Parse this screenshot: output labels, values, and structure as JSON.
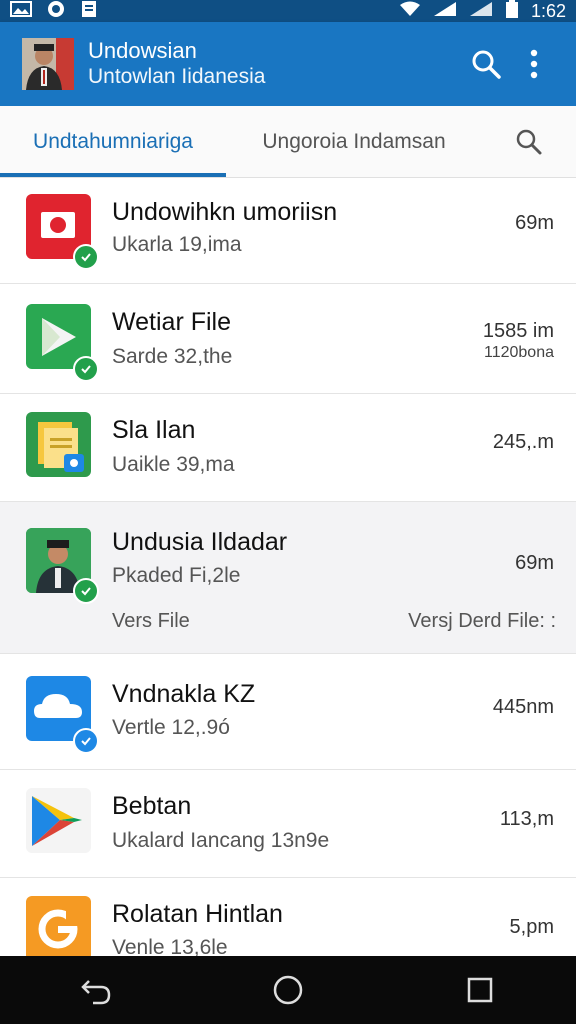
{
  "status_bar": {
    "time": "1:62",
    "icons": [
      "gallery-icon",
      "shield-icon",
      "clipboard-icon",
      "wifi-icon",
      "signal-icon",
      "signal-icon",
      "battery-icon"
    ]
  },
  "app_bar": {
    "title": "Undowsian",
    "subtitle": "Untowlan Iidanesia",
    "actions": [
      "search-icon",
      "more-vert-icon"
    ]
  },
  "tabs": [
    {
      "label": "Undtahumniariga",
      "active": true
    },
    {
      "label": "Ungoroia Indamsan",
      "active": false
    }
  ],
  "apps": [
    {
      "name": "Undowihkn umoriisn",
      "sub": "Ukarla 19,ima",
      "size": "69m",
      "size2": "",
      "icon": "red-app-icon",
      "badge": "green"
    },
    {
      "name": "Wetiar File",
      "sub": "Sarde 32,the",
      "size": "1585 im",
      "size2": "1120bona",
      "icon": "play-store-icon",
      "badge": "green"
    },
    {
      "name": "Sla Ilan",
      "sub": "Uaikle 39,ma",
      "size": "245,.m",
      "size2": "",
      "icon": "file-manager-icon",
      "badge": "none"
    },
    {
      "name": "Undusia Ildadar",
      "sub": "Pkaded Fi,2le",
      "size": "69m",
      "size2": "",
      "icon": "portrait-app-icon",
      "badge": "green",
      "extra_left": "Vers File",
      "extra_right": "Versj Derd File: :"
    },
    {
      "name": "Vndnakla KZ",
      "sub": "Vertle 12,.9ó",
      "size": "445nm",
      "size2": "",
      "icon": "cloud-icon",
      "badge": "blue"
    },
    {
      "name": "Bebtan",
      "sub": "Ukalard Iancang 13n9e",
      "size": "113,m",
      "size2": "",
      "icon": "play-triangle-icon",
      "badge": "none"
    },
    {
      "name": "Rolatan Hintlan",
      "sub": "Venle 13,6le",
      "size": "5,pm",
      "size2": "",
      "icon": "g-logo-icon",
      "badge": "none"
    }
  ],
  "nav": [
    "back-icon",
    "home-icon",
    "recents-icon"
  ],
  "colors": {
    "app_bar": "#1976c2",
    "status_bar": "#0f4f84",
    "accent": "#1a6fb5",
    "nav_bar": "#0a0a0a"
  }
}
